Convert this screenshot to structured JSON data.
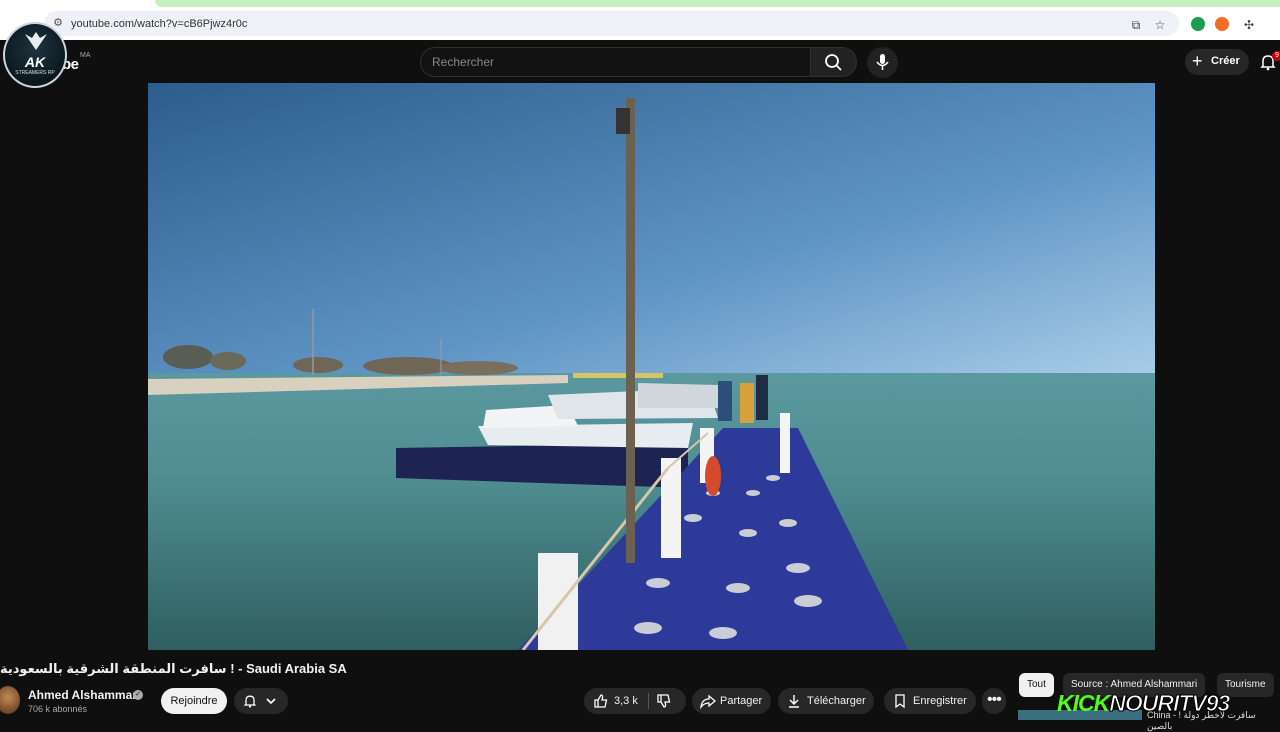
{
  "browser": {
    "url": "youtube.com/watch?v=cB6Pjwz4r0c"
  },
  "youtube": {
    "logo_word": "be",
    "region": "MA",
    "search_placeholder": "Rechercher",
    "create_label": "Créer",
    "notification_count": "9"
  },
  "overlay_logo": {
    "initials": "AK",
    "subtitle": "STREAMERS RP"
  },
  "video": {
    "title": "سافرت المنطقة الشرقية بالسعودية ! - Saudi Arabia SA",
    "channel_name": "Ahmed Alshammari",
    "subscribers": "706 k abonnés",
    "join_label": "Rejoindre",
    "likes": "3,3 k",
    "share_label": "Partager",
    "download_label": "Télécharger",
    "save_label": "Enregistrer"
  },
  "related_chips": [
    "Tout",
    "Source : Ahmed Alshammari",
    "Tourisme"
  ],
  "watermark": {
    "kick": "KICK",
    "channel": "NOURITV93"
  },
  "next_video": {
    "title": "China - ! سافرت لأخطر دولة بالصين"
  }
}
